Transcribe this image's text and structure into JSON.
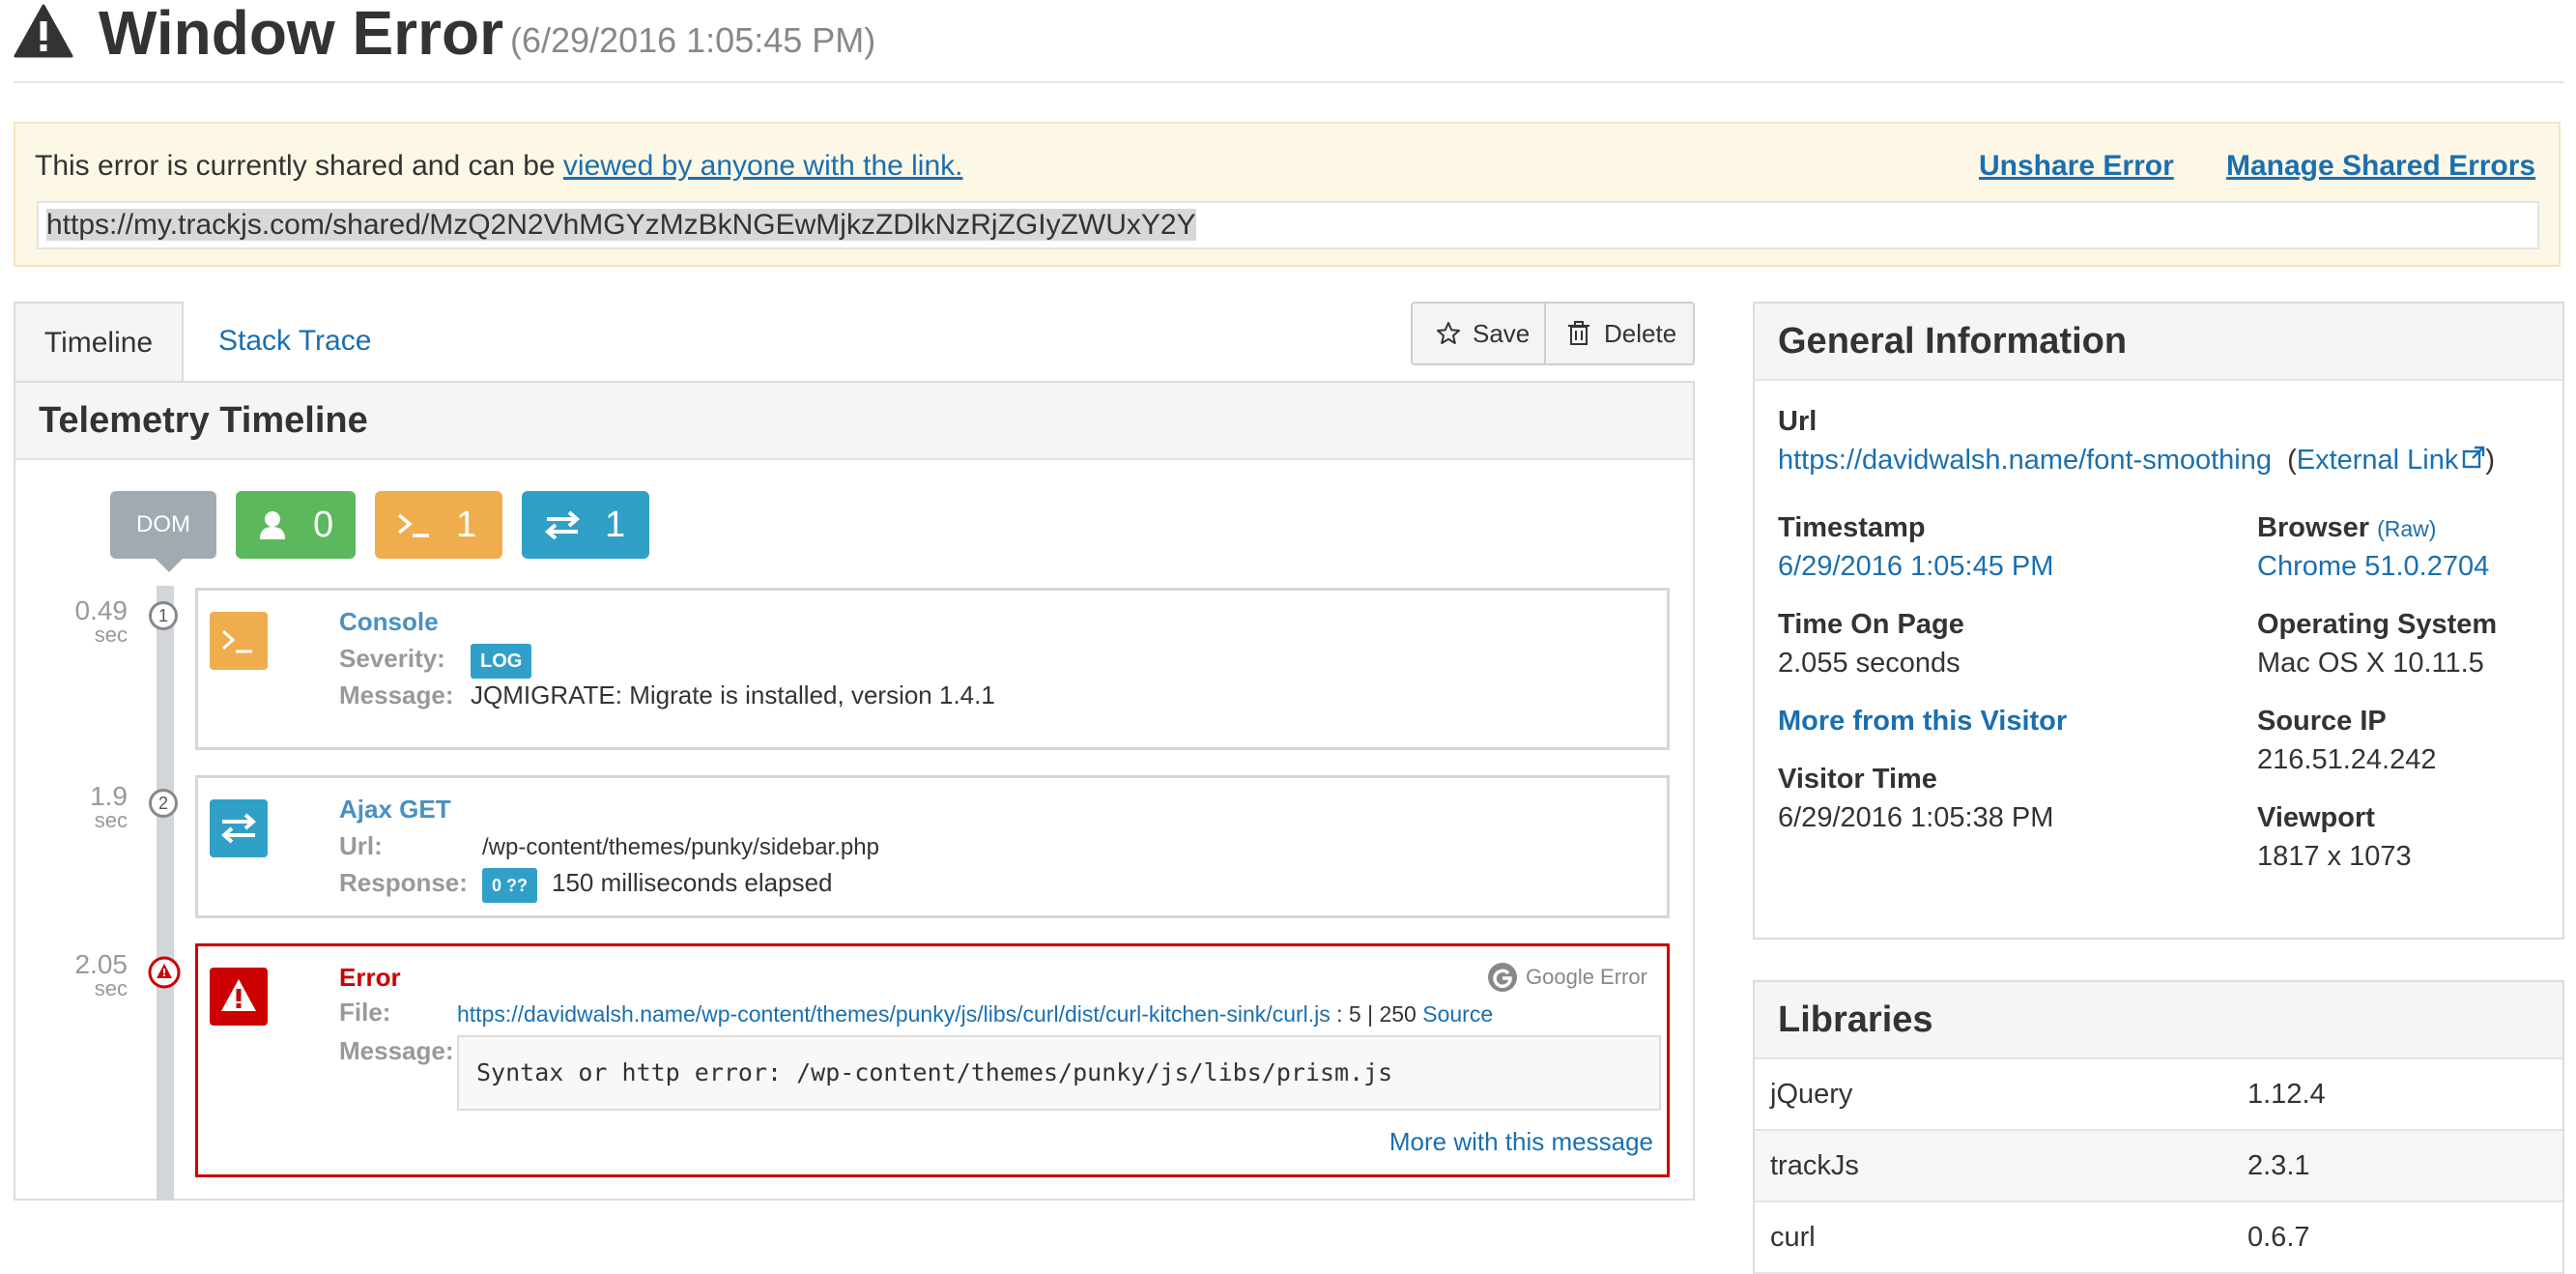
{
  "header": {
    "title": "Window Error",
    "timestamp": "(6/29/2016 1:05:45 PM)"
  },
  "share_banner": {
    "text": "This error is currently shared and can be ",
    "link_text": "viewed by anyone with the link.",
    "unshare_label": "Unshare Error",
    "manage_label": "Manage Shared Errors",
    "url": "https://my.trackjs.com/shared/MzQ2N2VhMGYzMzBkNGEwMjkzZDlkNzRjZGIyZWUxY2Y"
  },
  "tabs": [
    {
      "label": "Timeline",
      "active": true
    },
    {
      "label": "Stack Trace",
      "active": false
    }
  ],
  "toolbar": {
    "save_label": "Save",
    "delete_label": "Delete"
  },
  "timeline": {
    "title": "Telemetry Timeline",
    "filters": {
      "dom_label": "DOM",
      "user_count": "0",
      "console_count": "1",
      "network_count": "1"
    },
    "events": [
      {
        "time": "0.49",
        "unit": "sec",
        "step": "1",
        "type": "Console",
        "severity_label": "Severity:",
        "severity": "LOG",
        "message_label": "Message:",
        "message": "JQMIGRATE: Migrate is installed, version 1.4.1"
      },
      {
        "time": "1.9",
        "unit": "sec",
        "step": "2",
        "type": "Ajax GET",
        "url_label": "Url:",
        "url": "/wp-content/themes/punky/sidebar.php",
        "response_label": "Response:",
        "status": "0 ??",
        "response": "150 milliseconds elapsed"
      },
      {
        "time": "2.05",
        "unit": "sec",
        "type": "Error",
        "google_label": "Google Error",
        "file_label": "File:",
        "file": "https://davidwalsh.name/wp-content/themes/punky/js/libs/curl/dist/curl-kitchen-sink/curl.js",
        "file_position": ": 5 | 250",
        "source_label": "Source",
        "message_label": "Message:",
        "message": "Syntax or http error: /wp-content/themes/punky/js/libs/prism.js",
        "more_label": "More with this message"
      }
    ]
  },
  "general_info": {
    "title": "General Information",
    "url_label": "Url",
    "url": "https://davidwalsh.name/font-smoothing",
    "external_link_label": "External Link",
    "timestamp_label": "Timestamp",
    "timestamp": "6/29/2016 1:05:45 PM",
    "browser_label": "Browser",
    "browser_raw": "(Raw)",
    "browser": "Chrome 51.0.2704",
    "time_on_page_label": "Time On Page",
    "time_on_page": "2.055 seconds",
    "os_label": "Operating System",
    "os": "Mac OS X 10.11.5",
    "more_visitor_label": "More from this Visitor",
    "source_ip_label": "Source IP",
    "source_ip": "216.51.24.242",
    "visitor_time_label": "Visitor Time",
    "visitor_time": "6/29/2016 1:05:38 PM",
    "viewport_label": "Viewport",
    "viewport": "1817 x 1073"
  },
  "libraries": {
    "title": "Libraries",
    "rows": [
      {
        "name": "jQuery",
        "version": "1.12.4"
      },
      {
        "name": "trackJs",
        "version": "2.3.1"
      },
      {
        "name": "curl",
        "version": "0.6.7"
      }
    ]
  },
  "colors": {
    "link": "#1a6fb0",
    "console": "#f0ad4e",
    "network": "#31a0c8",
    "user": "#5cb85c",
    "dom": "#a2aab1",
    "error": "#cc0000",
    "banner_bg": "#fdf8e6"
  },
  "icons": {
    "title": "warning-triangle-icon",
    "save": "star-icon",
    "delete": "trash-icon",
    "user_filter": "user-icon",
    "console_filter": "terminal-icon",
    "network_filter": "exchange-icon",
    "google": "google-icon",
    "external": "external-link-icon"
  }
}
